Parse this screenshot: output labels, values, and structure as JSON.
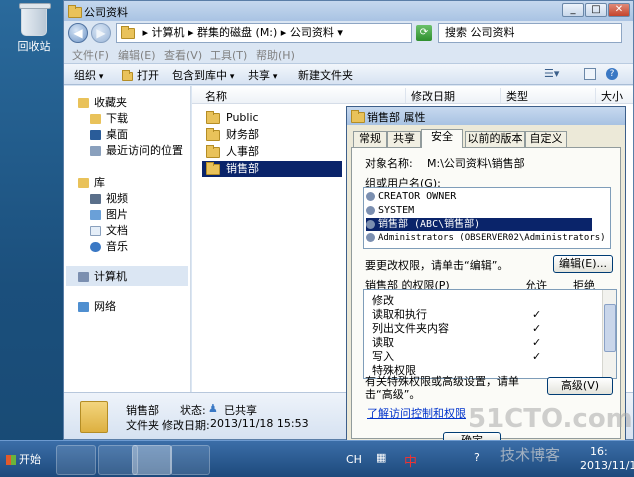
{
  "desktop": {
    "recycle_label": "回收站"
  },
  "explorer": {
    "title": "公司资料",
    "address": "▸ 计算机 ▸ 群集的磁盘 (M:) ▸ 公司资料 ▾",
    "search_placeholder": "搜索 公司资料",
    "menu": [
      "文件(F)",
      "编辑(E)",
      "查看(V)",
      "工具(T)",
      "帮助(H)"
    ],
    "toolbar": {
      "organize": "组织",
      "open": "打开",
      "include": "包含到库中",
      "share": "共享",
      "new_folder": "新建文件夹"
    },
    "nav": {
      "favorites": "收藏夹",
      "downloads": "下载",
      "desktop": "桌面",
      "recent": "最近访问的位置",
      "libraries": "库",
      "videos": "视频",
      "pictures": "图片",
      "documents": "文档",
      "music": "音乐",
      "computer": "计算机",
      "network": "网络"
    },
    "columns": {
      "name": "名称",
      "modified": "修改日期",
      "type": "类型",
      "size": "大小"
    },
    "files": [
      "Public",
      "财务部",
      "人事部",
      "销售部"
    ],
    "selected_file": "销售部",
    "details": {
      "name": "销售部",
      "state_label": "状态:",
      "state_value": "已共享",
      "type_text": "文件夹",
      "modified_label": "修改日期:",
      "modified_value": "2013/11/18 15:53"
    }
  },
  "dialog": {
    "title": "销售部 属性",
    "tabs": [
      "常规",
      "共享",
      "安全",
      "以前的版本",
      "自定义"
    ],
    "active_tab": "安全",
    "object_label": "对象名称:",
    "object_value": "M:\\公司资料\\销售部",
    "groups_label": "组或用户名(G):",
    "users": [
      "CREATOR OWNER",
      "SYSTEM",
      "销售部 (ABC\\销售部)",
      "Administrators (OBSERVER02\\Administrators)"
    ],
    "change_hint": "要更改权限，请单击“编辑”。",
    "edit_button": "编辑(E)...",
    "perm_header": "销售部 的权限(P)",
    "allow_header": "允许",
    "deny_header": "拒绝",
    "permissions": [
      "修改",
      "读取和执行",
      "列出文件夹内容",
      "读取",
      "写入",
      "特殊权限"
    ],
    "allowed": [
      false,
      true,
      true,
      true,
      true,
      false
    ],
    "special_hint": "有关特殊权限或高级设置，请单击“高级”。",
    "advanced_button": "高级(V)",
    "link": "了解访问控制和权限",
    "ok_button": "确定"
  },
  "taskbar": {
    "start": "开始",
    "lang": "CH",
    "ime": "中",
    "time": "16:",
    "date": "2013/11/18"
  },
  "watermark": {
    "site": "51CTO.com",
    "blog": "技术博客"
  },
  "colors": {
    "selection": "#0a246a",
    "window": "#dbe6f3",
    "dialog": "#ece9d8"
  }
}
